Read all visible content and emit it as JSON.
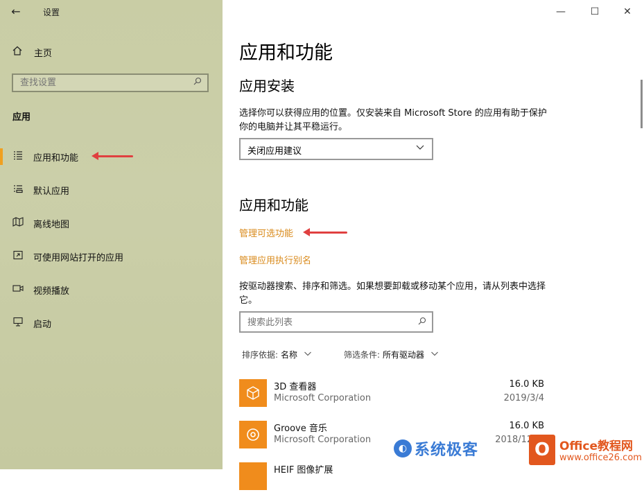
{
  "window": {
    "title": "设置",
    "minimize_glyph": "—",
    "maximize_glyph": "☐",
    "close_glyph": "✕"
  },
  "sidebar": {
    "back_glyph": "←",
    "home_label": "主页",
    "search_placeholder": "查找设置",
    "section": "应用",
    "items": [
      {
        "label": "应用和功能",
        "icon": "apps-features-icon",
        "active": true
      },
      {
        "label": "默认应用",
        "icon": "default-apps-icon",
        "active": false
      },
      {
        "label": "离线地图",
        "icon": "offline-maps-icon",
        "active": false
      },
      {
        "label": "可使用网站打开的应用",
        "icon": "apps-for-websites-icon",
        "active": false
      },
      {
        "label": "视频播放",
        "icon": "video-playback-icon",
        "active": false
      },
      {
        "label": "启动",
        "icon": "startup-icon",
        "active": false
      }
    ]
  },
  "main": {
    "title": "应用和功能",
    "install_heading": "应用安装",
    "install_desc": "选择你可以获得应用的位置。仅安装来自 Microsoft Store 的应用有助于保护你的电脑并让其平稳运行。",
    "install_dropdown_value": "关闭应用建议",
    "apps_heading": "应用和功能",
    "link_optional": "管理可选功能",
    "link_alias": "管理应用执行别名",
    "list_desc": "按驱动器搜索、排序和筛选。如果想要卸载或移动某个应用，请从列表中选择它。",
    "list_search_placeholder": "搜索此列表",
    "sort_label": "排序依据:",
    "sort_value": "名称",
    "filter_label": "筛选条件:",
    "filter_value": "所有驱动器",
    "apps": [
      {
        "name": "3D 查看器",
        "publisher": "Microsoft Corporation",
        "size": "16.0 KB",
        "date": "2019/3/4"
      },
      {
        "name": "Groove 音乐",
        "publisher": "Microsoft Corporation",
        "size": "16.0 KB",
        "date": "2018/12/..."
      },
      {
        "name": "HEIF 图像扩展",
        "publisher": "",
        "size": "",
        "date": ""
      }
    ]
  },
  "watermarks": {
    "left_text": "系统极客",
    "right_brand": "Office教程网",
    "right_url": "www.office26.com"
  },
  "colors": {
    "sidebar_bg": "#c9cda5",
    "accent": "#f0a020",
    "link": "#d98a1b",
    "app_icon": "#f08c1c",
    "annotation_arrow": "#e04040"
  }
}
